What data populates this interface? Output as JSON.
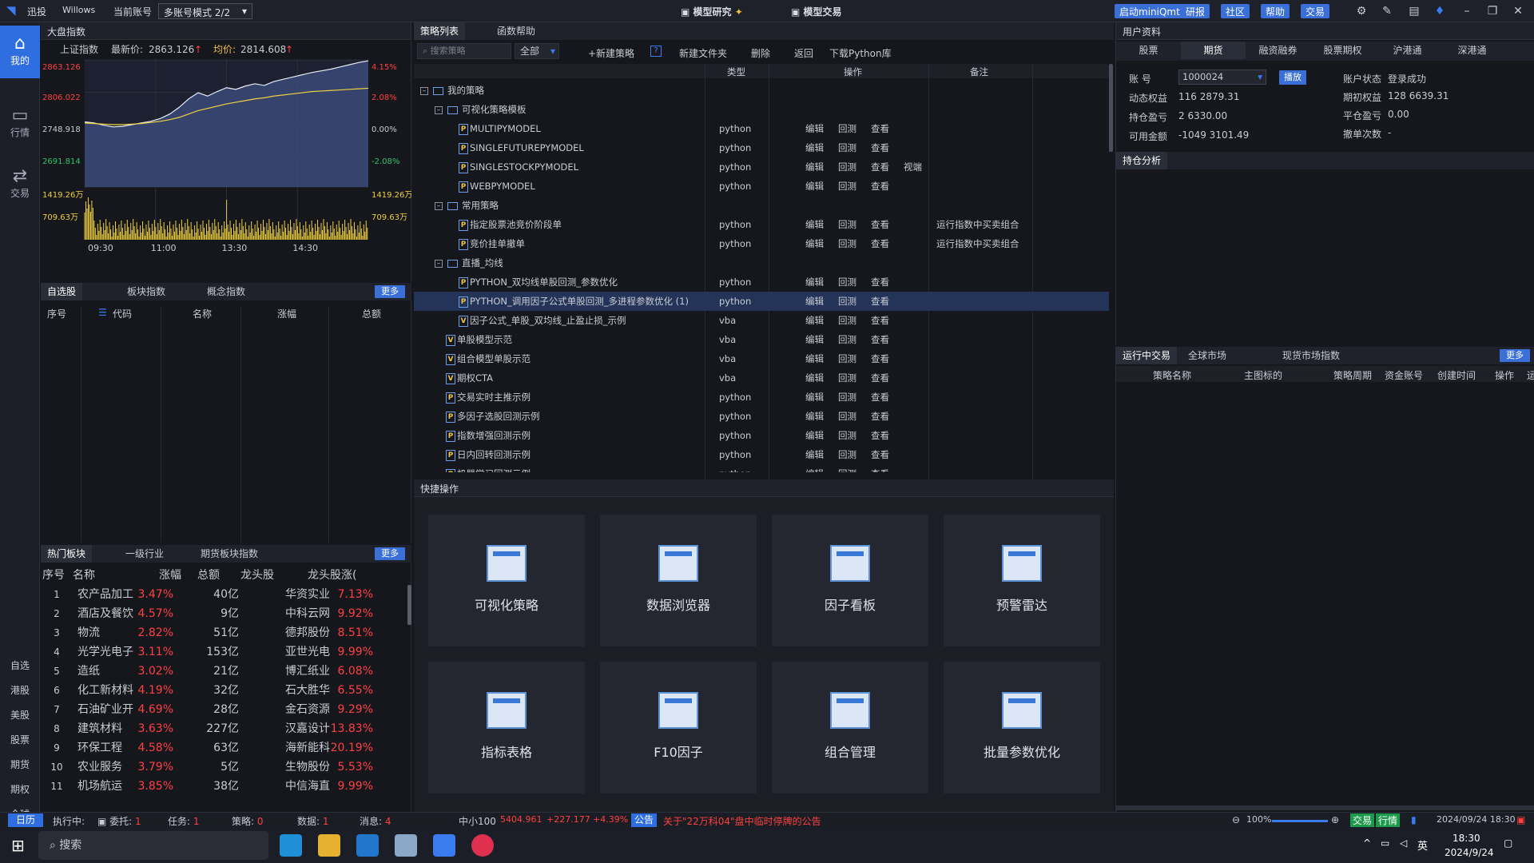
{
  "titlebar": {
    "app_name": "迅投",
    "user": "Willows",
    "account_label": "当前账号",
    "account_mode": "多账号模式 2/2",
    "center_tabs": [
      "模型研究",
      "模型交易"
    ],
    "right_buttons": [
      "启动miniQmt",
      "研报",
      "社区",
      "帮助",
      "交易"
    ]
  },
  "sidebar": {
    "items": [
      {
        "label": "我的",
        "icon": "home-icon"
      },
      {
        "label": "行情",
        "icon": "chart-icon"
      },
      {
        "label": "交易",
        "icon": "trade-icon"
      }
    ],
    "bottom": [
      "自选",
      "港股",
      "美股",
      "股票",
      "期货",
      "期权",
      "全球"
    ]
  },
  "market": {
    "title": "大盘指数",
    "index_name": "上证指数",
    "latest_label": "最新价:",
    "latest_value": "2863.126",
    "avg_label": "均价:",
    "avg_value": "2814.608",
    "y_labels_left": [
      "2863.126",
      "2806.022",
      "2748.918",
      "2691.814",
      "1419.26万",
      "709.63万"
    ],
    "y_labels_right": [
      "4.15%",
      "2.08%",
      "0.00%",
      "-2.08%",
      "1419.26万",
      "709.63万"
    ],
    "x_labels": [
      "09:30",
      "11:00",
      "13:30",
      "14:30"
    ],
    "price_series": [
      2754,
      2752,
      2748,
      2745,
      2746,
      2749,
      2752,
      2755,
      2760,
      2768,
      2780,
      2795,
      2806,
      2800,
      2808,
      2815,
      2812,
      2818,
      2822,
      2819,
      2826,
      2830,
      2834,
      2838,
      2842,
      2845,
      2848,
      2852,
      2856,
      2860,
      2863
    ],
    "avg_series": [
      2752,
      2751,
      2750,
      2749,
      2749,
      2750,
      2751,
      2753,
      2755,
      2758,
      2762,
      2768,
      2774,
      2778,
      2782,
      2786,
      2789,
      2792,
      2795,
      2797,
      2800,
      2802,
      2804,
      2806,
      2808,
      2809,
      2810,
      2811,
      2812,
      2813,
      2814
    ]
  },
  "watchlist": {
    "tabs": [
      "自选股",
      "板块指数",
      "概念指数"
    ],
    "more": "更多",
    "headers": [
      "序号",
      "代码",
      "名称",
      "涨幅",
      "总额"
    ]
  },
  "hot": {
    "tabs": [
      "热门板块",
      "一级行业",
      "期货板块指数"
    ],
    "more": "更多",
    "headers": [
      "序号",
      "名称",
      "涨幅",
      "总额",
      "龙头股",
      "龙头股涨("
    ],
    "rows": [
      [
        "1",
        "农产品加工",
        "3.47%",
        "40亿",
        "华资实业",
        "7.13%"
      ],
      [
        "2",
        "酒店及餐饮",
        "4.57%",
        "9亿",
        "中科云网",
        "9.92%"
      ],
      [
        "3",
        "物流",
        "2.82%",
        "51亿",
        "德邦股份",
        "8.51%"
      ],
      [
        "4",
        "光学光电子",
        "3.11%",
        "153亿",
        "亚世光电",
        "9.99%"
      ],
      [
        "5",
        "造纸",
        "3.02%",
        "21亿",
        "博汇纸业",
        "6.08%"
      ],
      [
        "6",
        "化工新材料",
        "4.19%",
        "32亿",
        "石大胜华",
        "6.55%"
      ],
      [
        "7",
        "石油矿业开",
        "4.69%",
        "28亿",
        "金石资源",
        "9.29%"
      ],
      [
        "8",
        "建筑材料",
        "3.63%",
        "227亿",
        "汉嘉设计",
        "13.83%"
      ],
      [
        "9",
        "环保工程",
        "4.58%",
        "63亿",
        "海新能科",
        "20.19%"
      ],
      [
        "10",
        "农业服务",
        "3.79%",
        "5亿",
        "生物股份",
        "5.53%"
      ],
      [
        "11",
        "机场航运",
        "3.85%",
        "38亿",
        "中信海直",
        "9.99%"
      ]
    ]
  },
  "strategy": {
    "tabs": [
      "策略列表",
      "函数帮助"
    ],
    "search_placeholder": "搜索策略",
    "filter": "全部",
    "toolbar": [
      "+新建策略",
      "?",
      "新建文件夹",
      "删除",
      "返回",
      "下载Python库"
    ],
    "headers": [
      "类型",
      "操作",
      "备注"
    ],
    "rows": [
      {
        "indent": 0,
        "kind": "root",
        "name": "我的策略",
        "type": "",
        "ops": [],
        "note": ""
      },
      {
        "indent": 1,
        "kind": "folder",
        "name": "可视化策略模板",
        "type": "",
        "ops": [],
        "note": ""
      },
      {
        "indent": 3,
        "kind": "p",
        "name": "MULTIPYMODEL",
        "type": "python",
        "ops": [
          "编辑",
          "回测",
          "查看"
        ],
        "note": ""
      },
      {
        "indent": 3,
        "kind": "p",
        "name": "SINGLEFUTUREPYMODEL",
        "type": "python",
        "ops": [
          "编辑",
          "回测",
          "查看"
        ],
        "note": ""
      },
      {
        "indent": 3,
        "kind": "p",
        "name": "SINGLESTOCKPYMODEL",
        "type": "python",
        "ops": [
          "编辑",
          "回测",
          "查看",
          "视端"
        ],
        "note": ""
      },
      {
        "indent": 3,
        "kind": "p",
        "name": "WEBPYMODEL",
        "type": "python",
        "ops": [
          "编辑",
          "回测",
          "查看"
        ],
        "note": ""
      },
      {
        "indent": 1,
        "kind": "folder",
        "name": "常用策略",
        "type": "",
        "ops": [],
        "note": ""
      },
      {
        "indent": 3,
        "kind": "p",
        "name": "指定股票池竞价阶段单",
        "type": "python",
        "ops": [
          "编辑",
          "回测",
          "查看"
        ],
        "note": "运行指数中买卖组合"
      },
      {
        "indent": 3,
        "kind": "p",
        "name": "竞价挂单撤单",
        "type": "python",
        "ops": [
          "编辑",
          "回测",
          "查看"
        ],
        "note": "运行指数中买卖组合"
      },
      {
        "indent": 1,
        "kind": "folder",
        "name": "直播_均线",
        "type": "",
        "ops": [],
        "note": ""
      },
      {
        "indent": 3,
        "kind": "p",
        "name": "PYTHON_双均线单股回测_参数优化",
        "type": "python",
        "ops": [
          "编辑",
          "回测",
          "查看"
        ],
        "note": ""
      },
      {
        "indent": 3,
        "kind": "p",
        "name": "PYTHON_调用因子公式单股回测_多进程参数优化 (1)",
        "type": "python",
        "ops": [
          "编辑",
          "回测",
          "查看"
        ],
        "note": "",
        "selected": true
      },
      {
        "indent": 3,
        "kind": "v",
        "name": "因子公式_单股_双均线_止盈止损_示例",
        "type": "vba",
        "ops": [
          "编辑",
          "回测",
          "查看"
        ],
        "note": ""
      },
      {
        "indent": 2,
        "kind": "v",
        "name": "单股模型示范",
        "type": "vba",
        "ops": [
          "编辑",
          "回测",
          "查看"
        ],
        "note": ""
      },
      {
        "indent": 2,
        "kind": "v",
        "name": "组合模型单股示范",
        "type": "vba",
        "ops": [
          "编辑",
          "回测",
          "查看"
        ],
        "note": ""
      },
      {
        "indent": 2,
        "kind": "v",
        "name": "期权CTA",
        "type": "vba",
        "ops": [
          "编辑",
          "回测",
          "查看"
        ],
        "note": ""
      },
      {
        "indent": 2,
        "kind": "p",
        "name": "交易实时主推示例",
        "type": "python",
        "ops": [
          "编辑",
          "回测",
          "查看"
        ],
        "note": ""
      },
      {
        "indent": 2,
        "kind": "p",
        "name": "多因子选股回测示例",
        "type": "python",
        "ops": [
          "编辑",
          "回测",
          "查看"
        ],
        "note": ""
      },
      {
        "indent": 2,
        "kind": "p",
        "name": "指数增强回测示例",
        "type": "python",
        "ops": [
          "编辑",
          "回测",
          "查看"
        ],
        "note": ""
      },
      {
        "indent": 2,
        "kind": "p",
        "name": "日内回转回测示例",
        "type": "python",
        "ops": [
          "编辑",
          "回测",
          "查看"
        ],
        "note": ""
      },
      {
        "indent": 2,
        "kind": "p",
        "name": "机器学习回测示例",
        "type": "python",
        "ops": [
          "编辑",
          "回测",
          "查看"
        ],
        "note": ""
      }
    ]
  },
  "quick": {
    "title": "快捷操作",
    "cards": [
      "可视化策略",
      "数据浏览器",
      "因子看板",
      "预警雷达",
      "指标表格",
      "F10因子",
      "组合管理",
      "批量参数优化"
    ]
  },
  "user": {
    "title": "用户资料",
    "tabs": [
      "股票",
      "期货",
      "融资融券",
      "股票期权",
      "沪港通",
      "深港通"
    ],
    "account_label": "账 号",
    "account_value": "1000024",
    "bind_btn": "播放",
    "rows_left": [
      [
        "动态权益",
        "116 2879.31"
      ],
      [
        "持仓盈亏",
        "2 6330.00"
      ],
      [
        "可用金额",
        "-1049 3101.49"
      ]
    ],
    "rows_right": [
      [
        "账户状态",
        "登录成功"
      ],
      [
        "期初权益",
        "128 6639.31"
      ],
      [
        "平仓盈亏",
        "0.00"
      ],
      [
        "撤单次数",
        "-"
      ]
    ],
    "position_title": "持仓分析"
  },
  "running": {
    "tabs": [
      "运行中交易",
      "全球市场",
      "现货市场指数"
    ],
    "more": "更多",
    "headers": [
      "策略名称",
      "主图标的",
      "策略周期",
      "资金账号",
      "创建时间",
      "操作",
      "运"
    ]
  },
  "status": {
    "items": [
      [
        "日历",
        ""
      ],
      [
        "执行中:",
        ""
      ],
      [
        "委托:",
        "1"
      ],
      [
        "任务:",
        "1"
      ],
      [
        "策略:",
        "0"
      ],
      [
        "数据:",
        "1"
      ],
      [
        "消息:",
        "4"
      ]
    ],
    "index_name": "中小100",
    "index_value": "5404.961",
    "index_change": "+227.177",
    "index_pct": "+4.39%",
    "notice_label": "公告",
    "notice": "关于\"22万科04\"盘中临时停牌的公告",
    "zoom": "100%",
    "trade_tag": "交易",
    "quote_tag": "行情",
    "datetime": "2024/09/24 18:30"
  },
  "taskbar": {
    "search": "搜索",
    "time": "18:30",
    "date": "2024/9/24",
    "ime": "英"
  }
}
